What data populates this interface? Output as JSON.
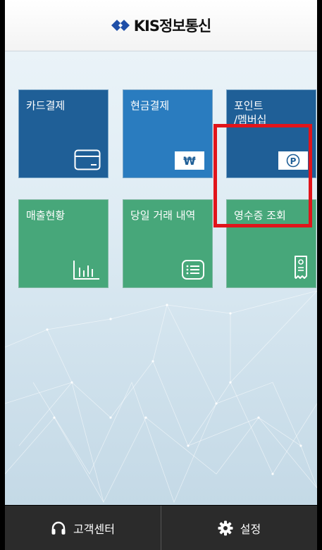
{
  "header": {
    "logo_text": "KIS정보통신",
    "logo_color": "#1f4fa8"
  },
  "tiles": [
    {
      "label": "카드결제",
      "icon": "card-icon",
      "color": "#1f5f97"
    },
    {
      "label": "현금결제",
      "icon": "won-icon",
      "color": "#2a7cbf"
    },
    {
      "label": "포인트\n/멤버십",
      "icon": "point-icon",
      "color": "#1f5f97"
    },
    {
      "label": "매출현황",
      "icon": "bar-chart-icon",
      "color": "#47a77a"
    },
    {
      "label": "당일 거래 내역",
      "icon": "list-icon",
      "color": "#47a77a"
    },
    {
      "label": "영수증 조회",
      "icon": "receipt-icon",
      "color": "#47a77a"
    }
  ],
  "won_symbol": "₩",
  "point_symbol": "P",
  "highlight_color": "#e1141b",
  "footer": {
    "support_label": "고객센터",
    "support_icon": "headset-icon",
    "settings_label": "설정",
    "settings_icon": "gear-icon"
  }
}
